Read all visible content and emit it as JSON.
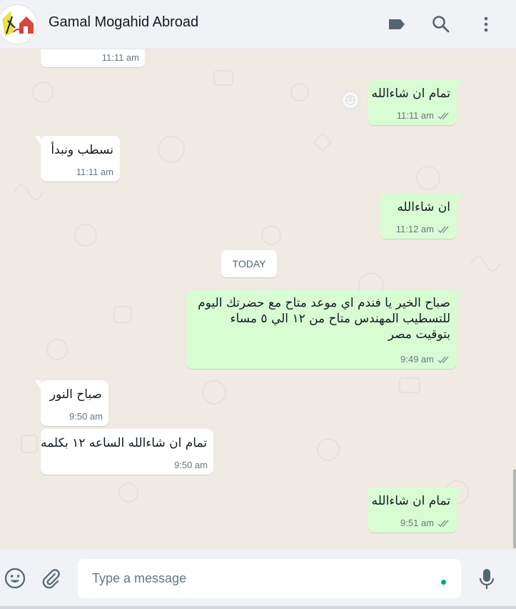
{
  "header": {
    "contact_name": "Gamal Mogahid Abroad",
    "icons": [
      "label-icon",
      "search-icon",
      "menu-icon"
    ]
  },
  "messages": [
    {
      "dir": "in",
      "text": "",
      "time": "11:11 am"
    },
    {
      "dir": "out",
      "text": "تمام ان شاءالله",
      "time": "11:11 am",
      "ticks": "double"
    },
    {
      "dir": "in",
      "text": "نسطب ونبدأ",
      "time": "11:11 am"
    },
    {
      "dir": "out",
      "text": "ان شاءالله",
      "time": "11:12 am",
      "ticks": "double"
    },
    {
      "dir": "out",
      "text": "صباح الخير يا فندم اي موعد متاح مع حضرتك اليوم\nللتسطيب المهندس متاح من ١٢ الي ٥ مساء\nبتوقيت مصر",
      "time": "9:49 am",
      "ticks": "double"
    },
    {
      "dir": "in",
      "text": "صباح النور",
      "time": "9:50 am"
    },
    {
      "dir": "in",
      "text": "تمام ان شاءالله الساعه ١٢ بكلمه",
      "time": "9:50 am"
    },
    {
      "dir": "out",
      "text": "تمام ان شاءالله",
      "time": "9:51 am",
      "ticks": "double"
    }
  ],
  "date_divider": "TODAY",
  "composer": {
    "placeholder": "Type a message",
    "icons": [
      "emoji-icon",
      "attach-icon",
      "mic-icon"
    ]
  },
  "colors": {
    "outgoing_bubble": "#d9fdd3",
    "incoming_bubble": "#ffffff",
    "chat_background": "#efeae2",
    "tick_color": "#8696a0",
    "accent": "#00a884"
  }
}
